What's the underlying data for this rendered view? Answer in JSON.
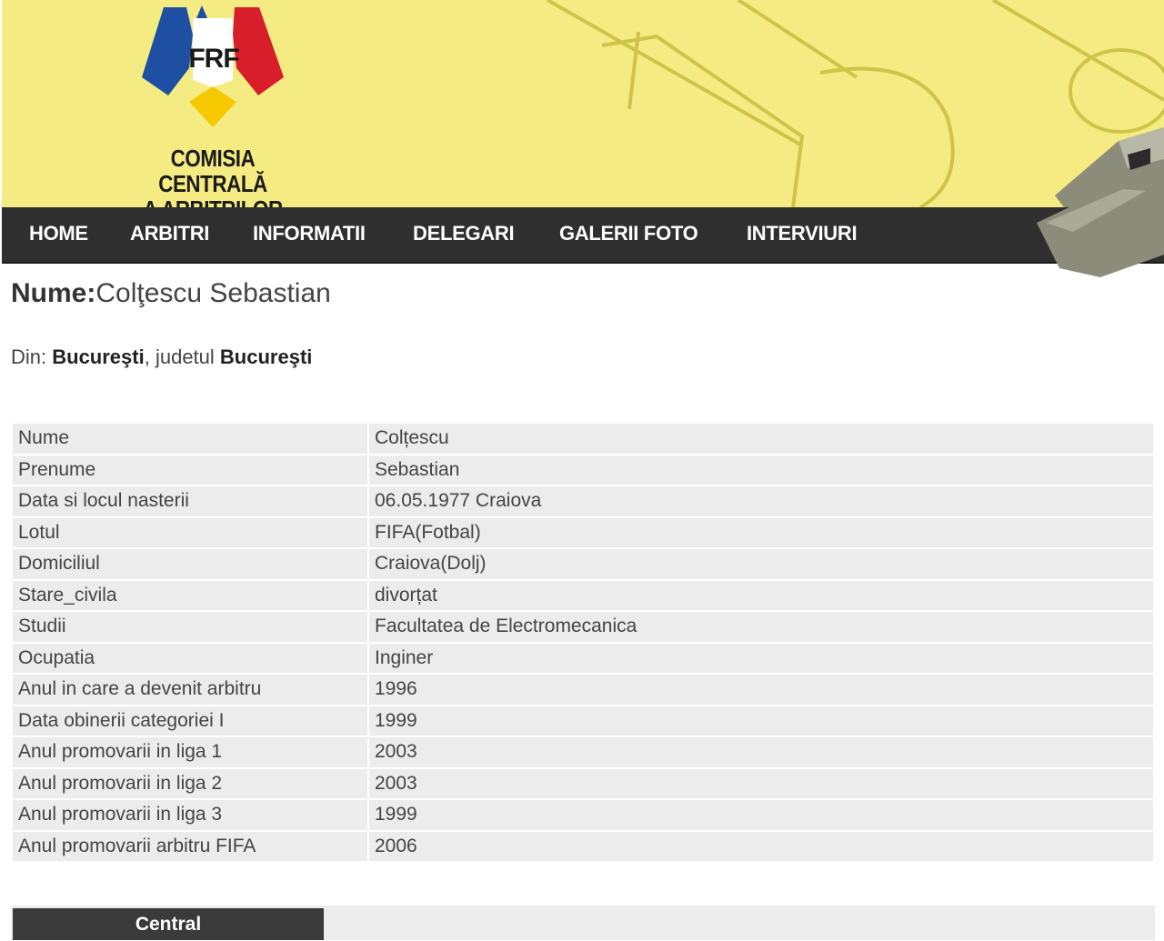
{
  "header": {
    "logo_text": "FRF",
    "org_line1": "COMISIA CENTRALĂ",
    "org_line2": "A ARBITRILOR"
  },
  "nav": {
    "items": [
      "HOME",
      "ARBITRI",
      "INFORMATII",
      "DELEGARI",
      "GALERII FOTO",
      "INTERVIURI"
    ]
  },
  "profile": {
    "name_label": "Nume:",
    "name_value": "Colţescu Sebastian",
    "from_label": "Din: ",
    "city": "Bucureşti",
    "county_label": ", judetul ",
    "county": "Bucureşti"
  },
  "details": [
    {
      "label": "Nume",
      "value": "Colțescu"
    },
    {
      "label": "Prenume",
      "value": "Sebastian"
    },
    {
      "label": "Data si locul nasterii",
      "value": "06.05.1977 Craiova"
    },
    {
      "label": "Lotul",
      "value": "FIFA(Fotbal)"
    },
    {
      "label": "Domiciliul",
      "value": "Craiova(Dolj)"
    },
    {
      "label": "Stare_civila",
      "value": "divorțat"
    },
    {
      "label": "Studii",
      "value": "Facultatea de Electromecanica"
    },
    {
      "label": "Ocupatia",
      "value": "Inginer"
    },
    {
      "label": "Anul in care a devenit arbitru",
      "value": "1996"
    },
    {
      "label": "Data obinerii categoriei I",
      "value": "1999"
    },
    {
      "label": "Anul promovarii in liga 1",
      "value": "2003"
    },
    {
      "label": "Anul promovarii in liga 2",
      "value": "2003"
    },
    {
      "label": "Anul promovarii in liga 3",
      "value": "1999"
    },
    {
      "label": "Anul promovarii arbitru FIFA",
      "value": "2006"
    }
  ],
  "tabs": {
    "central": "Central"
  },
  "colors": {
    "banner_bg": "#f4ec82",
    "nav_bg": "#2f2f2f",
    "table_cell_bg": "#ececec",
    "logo_blue": "#1f4fa3",
    "logo_yellow": "#f6c800",
    "logo_red": "#d81e2a"
  }
}
